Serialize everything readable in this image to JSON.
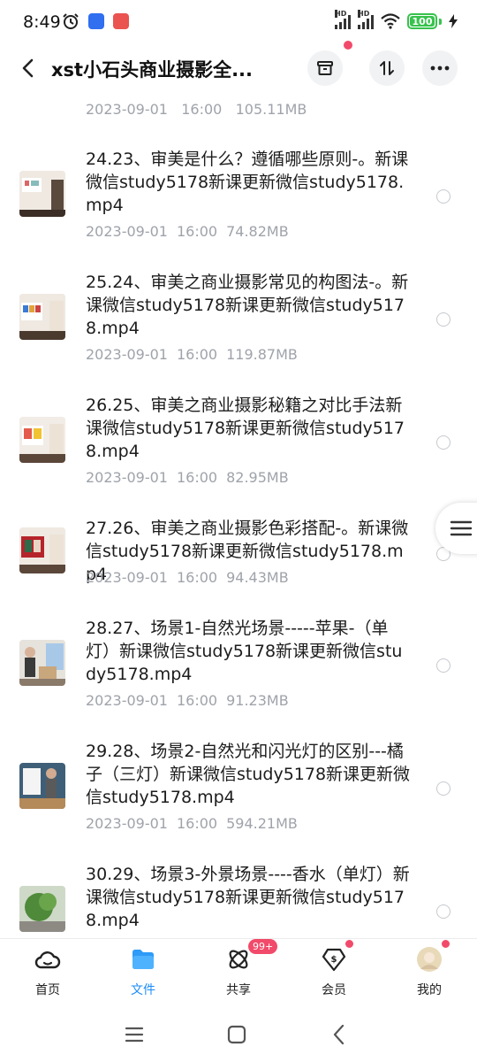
{
  "status_bar": {
    "time": "8:49",
    "battery": "100",
    "network_tag_1": "HD",
    "network_tag_2": "HD"
  },
  "header": {
    "title": "xst小石头商业摄影全..."
  },
  "list": {
    "top_partial_meta": {
      "date": "2023-09-01",
      "time": "16:00",
      "size": "105.11MB"
    },
    "items": [
      {
        "name": "24.23、审美是什么？遵循哪些原则-。新课微信study5178新课更新微信study5178.mp4",
        "date": "2023-09-01",
        "time": "16:00",
        "size": "74.82MB"
      },
      {
        "name": "25.24、审美之商业摄影常见的构图法-。新课微信study5178新课更新微信study5178.mp4",
        "date": "2023-09-01",
        "time": "16:00",
        "size": "119.87MB"
      },
      {
        "name": "26.25、审美之商业摄影秘籍之对比手法新课微信study5178新课更新微信study5178.mp4",
        "date": "2023-09-01",
        "time": "16:00",
        "size": "82.95MB"
      },
      {
        "name": "27.26、审美之商业摄影色彩搭配-。新课微信study5178新课更新微信study5178.mp4",
        "date": "2023-09-01",
        "time": "16:00",
        "size": "94.43MB"
      },
      {
        "name": "28.27、场景1-自然光场景-----苹果-（单灯）新课微信study5178新课更新微信study5178.mp4",
        "date": "2023-09-01",
        "time": "16:00",
        "size": "91.23MB"
      },
      {
        "name": "29.28、场景2-自然光和闪光灯的区别---橘子（三灯）新课微信study5178新课更新微信study5178.mp4",
        "date": "2023-09-01",
        "time": "16:00",
        "size": "594.21MB"
      },
      {
        "name": "30.29、场景3-外景场景----香水（单灯）新课微信study5178新课更新微信study5178.mp4",
        "date": "",
        "time": "",
        "size": ""
      }
    ]
  },
  "bottom_nav": {
    "items": [
      {
        "label": "首页",
        "icon": "cloud-home-icon"
      },
      {
        "label": "文件",
        "icon": "folder-icon"
      },
      {
        "label": "共享",
        "icon": "share-atom-icon"
      },
      {
        "label": "会员",
        "icon": "vip-dollar-icon"
      },
      {
        "label": "我的",
        "icon": "avatar"
      }
    ],
    "share_badge": "99+"
  },
  "colors": {
    "accent": "#1b8cf7",
    "badge": "#f24a6a",
    "meta_text": "#9fa3aa",
    "battery": "#37c24c"
  }
}
